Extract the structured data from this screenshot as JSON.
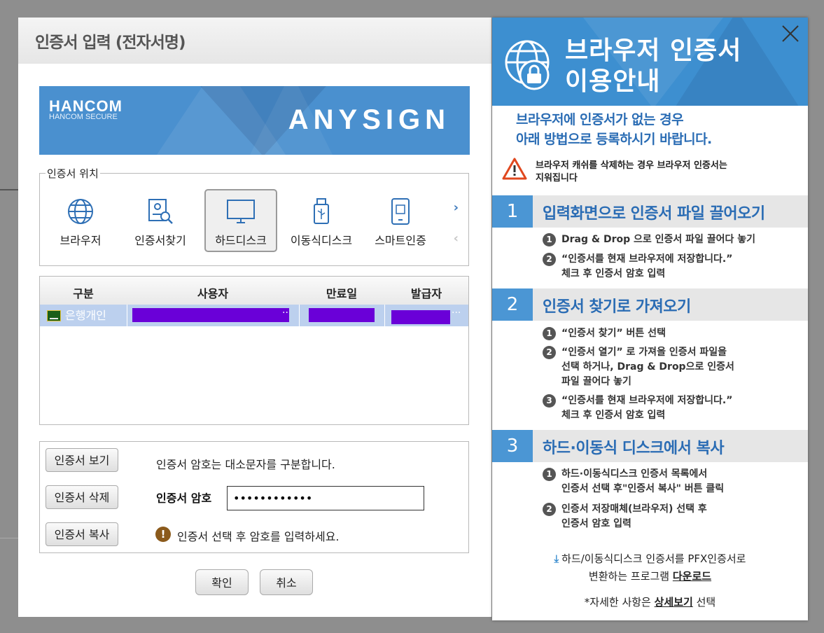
{
  "dialog": {
    "title": "인증서 입력 (전자서명)",
    "banner": {
      "logo": "HANCOM",
      "logo_sub": "HANCOM SECURE",
      "product": "ANYSIGN"
    },
    "location": {
      "legend": "인증서 위치",
      "items": [
        {
          "label": "브라우저",
          "icon": "globe-icon"
        },
        {
          "label": "인증서찾기",
          "icon": "certificate-search-icon"
        },
        {
          "label": "하드디스크",
          "icon": "monitor-icon",
          "selected": true
        },
        {
          "label": "이동식디스크",
          "icon": "usb-icon"
        },
        {
          "label": "스마트인증",
          "icon": "smartphone-icon"
        }
      ]
    },
    "table": {
      "headers": [
        "구분",
        "사용자",
        "만료일",
        "발급자"
      ],
      "rows": [
        {
          "type": "은행개인",
          "user_tail": "..",
          "issuer_tail": "..."
        }
      ]
    },
    "buttons": {
      "view": "인증서 보기",
      "delete": "인증서 삭제",
      "copy": "인증서 복사",
      "ok": "확인",
      "cancel": "취소"
    },
    "case_note": "인증서 암호는 대소문자를 구분합니다.",
    "password": {
      "label": "인증서 암호",
      "value": "••••••••••••"
    },
    "hint": "인증서 선택 후 암호를 입력하세요."
  },
  "panel": {
    "title_line1": "브라우저 인증서",
    "title_line2": "이용안내",
    "intro_line1": "브라우저에 인증서가 없는 경우",
    "intro_line2": "아래 방법으로 등록하시기 바랍니다.",
    "warning_line1": "브라우저 캐쉬를 삭제하는 경우 브라우저 인증서는",
    "warning_line2": "지워집니다",
    "sections": [
      {
        "num": "1",
        "title": "입력화면으로 인증서 파일 끌어오기",
        "steps": [
          {
            "n": "1",
            "lines": [
              "Drag & Drop 으로 인증서 파일 끌어다 놓기"
            ]
          },
          {
            "n": "2",
            "lines": [
              "“인증서를 현재 브라우저에 저장합니다.”",
              "체크 후 인증서 암호 입력"
            ]
          }
        ]
      },
      {
        "num": "2",
        "title": "인증서 찾기로 가져오기",
        "steps": [
          {
            "n": "1",
            "lines": [
              "“인증서 찾기” 버튼 선택"
            ]
          },
          {
            "n": "2",
            "lines": [
              "“인증서 열기” 로 가져올 인증서 파일을",
              "선택 하거나, Drag & Drop으로 인증서",
              "파일 끌어다 놓기"
            ]
          },
          {
            "n": "3",
            "lines": [
              "“인증서를 현재 브라우저에 저장합니다.”",
              "체크 후 인증서 암호 입력"
            ]
          }
        ]
      },
      {
        "num": "3",
        "title": "하드·이동식 디스크에서 복사",
        "steps": [
          {
            "n": "1",
            "lines": [
              "하드·이동식디스크 인증서 목록에서",
              "인증서 선택 후\"인증서 복사\" 버튼 클릭"
            ]
          },
          {
            "n": "2",
            "lines": [
              "인증서 저장매체(브라우저) 선택 후",
              "인증서 암호 입력"
            ]
          }
        ]
      }
    ],
    "download_line1": "하드/이동식디스크 인증서를 PFX인증서로",
    "download_line2_pre": "변환하는 프로그램 ",
    "download_link": "다운로드",
    "detail_pre": "*자세한 사항은 ",
    "detail_link": "상세보기",
    "detail_post": " 선택"
  }
}
